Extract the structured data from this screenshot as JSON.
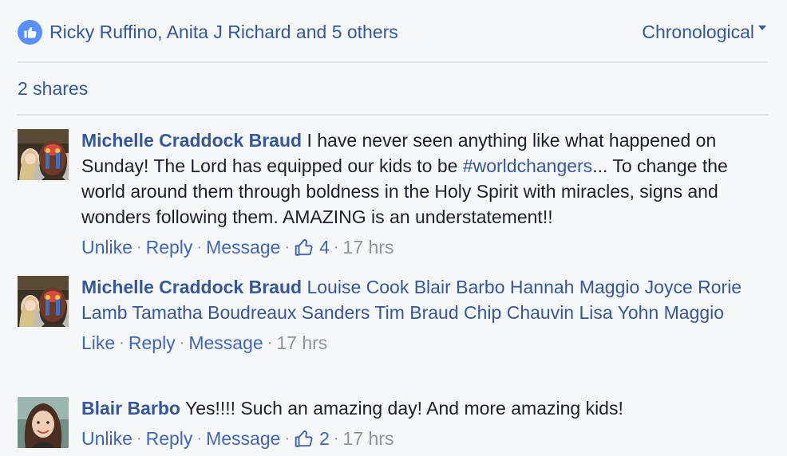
{
  "likes": {
    "names": "Ricky Ruffino, Anita J Richard and 5 others",
    "icon": "like-thumb-icon"
  },
  "sort": {
    "label": "Chronological"
  },
  "shares": {
    "label": "2 shares"
  },
  "comments": [
    {
      "author": "Michelle Craddock Braud",
      "text_before": " I have never seen anything like what happened on Sunday! The Lord has equipped our kids to be ",
      "hashtag": "#worldchangers",
      "text_after": "... To change the world around them through boldness in the Holy Spirit with miracles, signs and wonders following them. AMAZING is an understatement!!",
      "actions": {
        "like": "Unlike",
        "reply": "Reply",
        "message": "Message"
      },
      "reactions": "4",
      "time": "17 hrs"
    },
    {
      "author": "Michelle Craddock Braud",
      "mentions": "Louise Cook Blair Barbo Hannah Maggio Joyce Rorie Lamb Tamatha Boudreaux Sanders Tim Braud Chip Chauvin Lisa Yohn Maggio",
      "actions": {
        "like": "Like",
        "reply": "Reply",
        "message": "Message"
      },
      "time": "17 hrs"
    },
    {
      "author": "Blair Barbo",
      "text": " Yes!!!! Such an amazing day! And more amazing kids!",
      "actions": {
        "like": "Unlike",
        "reply": "Reply",
        "message": "Message"
      },
      "reactions": "2",
      "time": "17 hrs"
    }
  ],
  "separator": "·",
  "colors": {
    "link": "#365899",
    "action": "#4267b2",
    "meta": "#90949c",
    "background": "#f6f7f9",
    "like_badge": "#5890ff"
  }
}
